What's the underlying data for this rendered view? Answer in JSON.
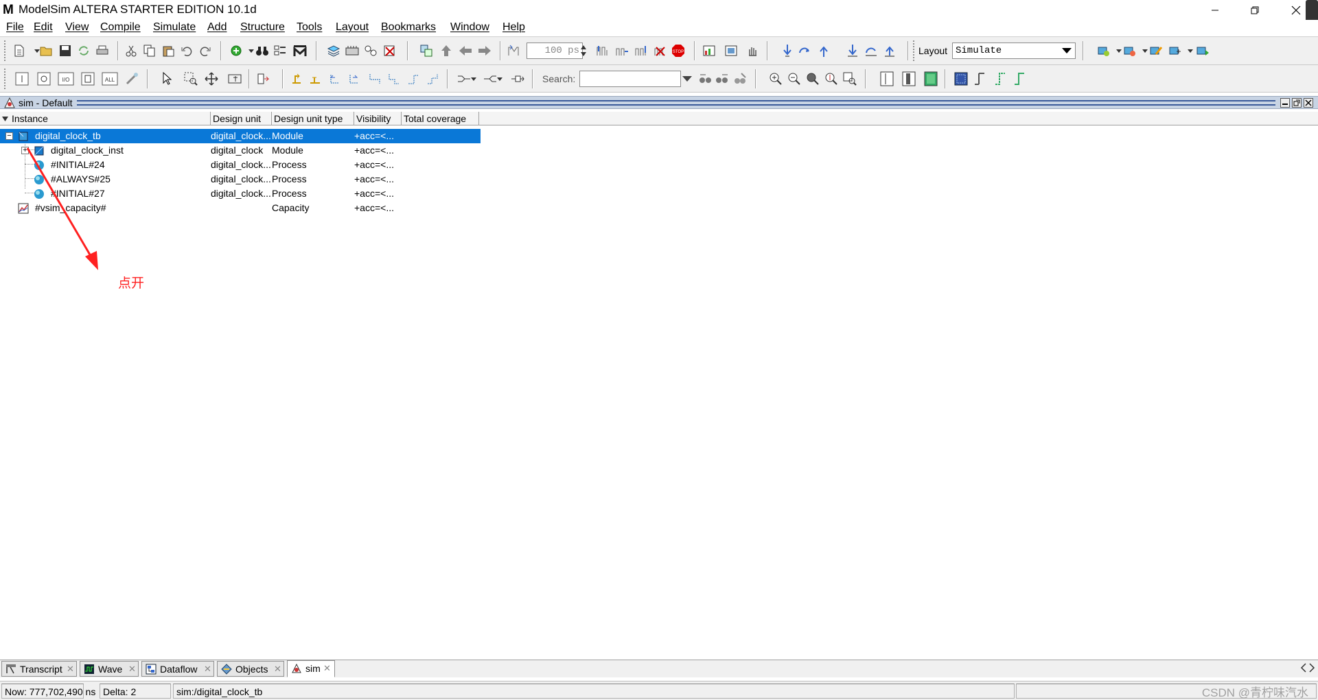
{
  "window": {
    "title": "ModelSim ALTERA STARTER EDITION 10.1d",
    "logo_text": "M"
  },
  "menu": [
    {
      "label": "File"
    },
    {
      "label": "Edit"
    },
    {
      "label": "View"
    },
    {
      "label": "Compile"
    },
    {
      "label": "Simulate"
    },
    {
      "label": "Add"
    },
    {
      "label": "Structure"
    },
    {
      "label": "Tools"
    },
    {
      "label": "Layout"
    },
    {
      "label": "Bookmarks"
    },
    {
      "label": "Window"
    },
    {
      "label": "Help"
    }
  ],
  "toolbar": {
    "run_length": "100 ps",
    "layout_label": "Layout",
    "layout_value": "Simulate",
    "search_label": "Search:",
    "search_value": "",
    "stop_text": "STOP",
    "all_text": "ALL",
    "io_text": "I/O"
  },
  "pane": {
    "title": "sim - Default"
  },
  "columns": [
    "Instance",
    "Design unit",
    "Design unit type",
    "Visibility",
    "Total coverage"
  ],
  "tree_rows": [
    {
      "instance": "digital_clock_tb",
      "design_unit": "digital_clock...",
      "type": "Module",
      "visibility": "+acc=<...",
      "coverage": ""
    },
    {
      "instance": "digital_clock_inst",
      "design_unit": "digital_clock",
      "type": "Module",
      "visibility": "+acc=<...",
      "coverage": ""
    },
    {
      "instance": "#INITIAL#24",
      "design_unit": "digital_clock...",
      "type": "Process",
      "visibility": "+acc=<...",
      "coverage": ""
    },
    {
      "instance": "#ALWAYS#25",
      "design_unit": "digital_clock...",
      "type": "Process",
      "visibility": "+acc=<...",
      "coverage": ""
    },
    {
      "instance": "#INITIAL#27",
      "design_unit": "digital_clock...",
      "type": "Process",
      "visibility": "+acc=<...",
      "coverage": ""
    },
    {
      "instance": "#vsim_capacity#",
      "design_unit": "",
      "type": "Capacity",
      "visibility": "+acc=<...",
      "coverage": ""
    }
  ],
  "annotation": {
    "text": "点开",
    "color": "#ff2020"
  },
  "tabs": [
    {
      "label": "Transcript"
    },
    {
      "label": "Wave"
    },
    {
      "label": "Dataflow"
    },
    {
      "label": "Objects"
    },
    {
      "label": "sim"
    }
  ],
  "status": {
    "now": "Now: 777,702,490 ns",
    "delta": "Delta: 2",
    "context": "sim:/digital_clock_tb"
  },
  "watermark": "CSDN @青柠味汽水",
  "colors": {
    "selection": "#0a78d7",
    "pane_header": "#c8d4e4",
    "arrow": "#ff2020"
  }
}
